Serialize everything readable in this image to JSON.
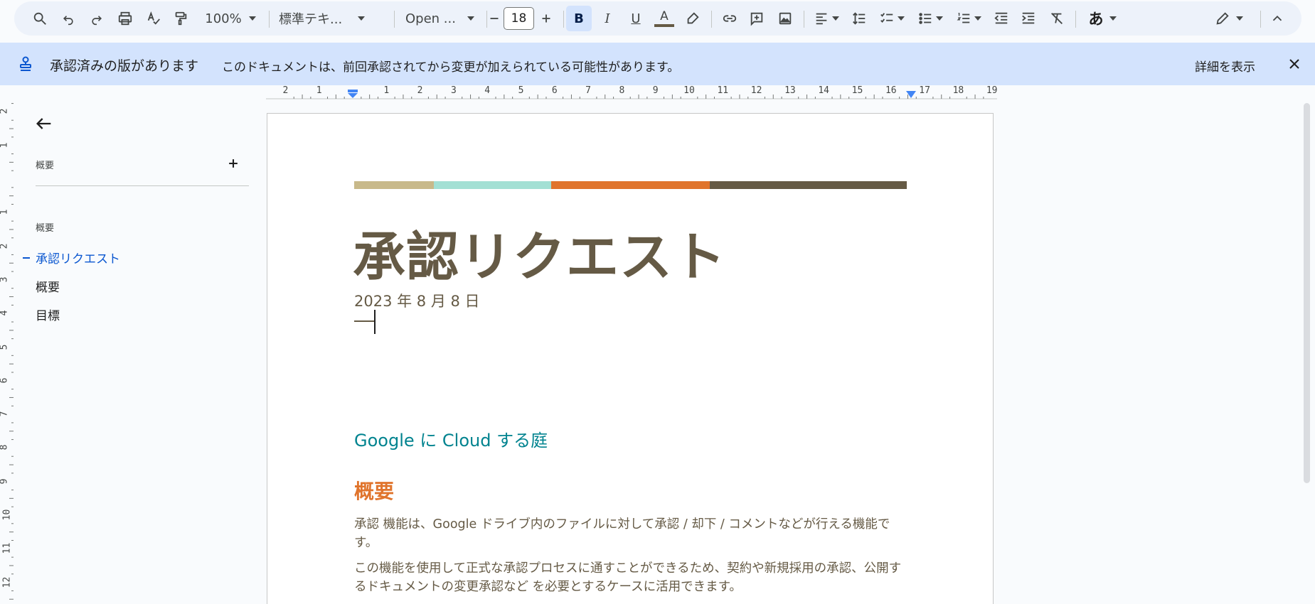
{
  "toolbar": {
    "zoom": "100%",
    "style": "標準テキ...",
    "font": "Open ...",
    "font_size": "18",
    "bold": "B",
    "italic": "I",
    "underline": "U",
    "text_color": "A",
    "input_tools": "あ"
  },
  "banner": {
    "title": "承認済みの版があります",
    "message": "このドキュメントは、前回承認されてから変更が加えられている可能性があります。",
    "details_link": "詳細を表示"
  },
  "ruler": {
    "horizontal": [
      "2",
      "1",
      "",
      "1",
      "2",
      "3",
      "4",
      "5",
      "6",
      "7",
      "8",
      "9",
      "10",
      "11",
      "12",
      "13",
      "14",
      "15",
      "16",
      "17",
      "18",
      "19"
    ],
    "vertical": [
      "2",
      "1",
      "",
      "1",
      "2",
      "3",
      "4",
      "5",
      "6",
      "7",
      "8",
      "9",
      "10",
      "11",
      "12"
    ]
  },
  "outline": {
    "title": "概要",
    "section": "概要",
    "items": [
      {
        "label": "承認リクエスト",
        "active": true
      },
      {
        "label": "概要",
        "active": false
      },
      {
        "label": "目標",
        "active": false
      }
    ]
  },
  "document": {
    "color_bar": [
      "#c8b98a",
      "#a3e0d4",
      "#e0742c",
      "#655a45"
    ],
    "title": "承認リクエスト",
    "date": "2023 年 8 月 8 日",
    "subtitle": "Google に Cloud する庭",
    "heading": "概要",
    "paragraphs": [
      "承認 機能は、Google ドライブ内のファイルに対して承認 / 却下 / コメントなどが行える機能です。",
      "この機能を使用して正式な承認プロセスに通すことができるため、契約や新規採用の承認、公開するドキュメントの変更承認など を必要とするケースに活用できます。"
    ]
  }
}
